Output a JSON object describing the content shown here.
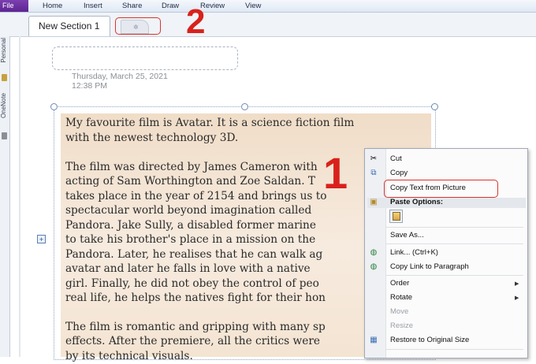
{
  "menubar": {
    "file_label": "File",
    "items": [
      "Home",
      "Insert",
      "Share",
      "Draw",
      "Review",
      "View"
    ]
  },
  "section_tab": {
    "label": "New Section 1"
  },
  "new_tab_icon": "sparkle-icon",
  "annotations": {
    "marker_1": "1",
    "marker_2": "2",
    "accent_color": "#d9211c"
  },
  "sidebar": {
    "labels": [
      "Personal",
      "OneNote"
    ]
  },
  "page": {
    "date": "Thursday, March 25, 2021",
    "time": "12:38 PM"
  },
  "picture_text": {
    "lines": [
      "My favourite film is Avatar. It is a science fiction film",
      "with the newest technology 3D.",
      "",
      "The film was directed by James Cameron with",
      "acting of Sam Worthington and Zoe Saldan. T",
      "takes place in the year of 2154 and brings us to",
      "spectacular world beyond imagination called",
      "Pandora. Jake Sully, a disabled former marine",
      "to take his brother's place in a mission on the",
      "Pandora. Later, he realises that he can walk ag",
      "avatar and later he falls in love with a native",
      "girl. Finally, he did not obey the control of peo",
      "real life, he helps the natives fight for their hon",
      "",
      "The film is romantic and gripping with many sp",
      "effects. After the premiere, all the critics were",
      "by its technical visuals."
    ]
  },
  "context_menu": {
    "cut": "Cut",
    "copy": "Copy",
    "copy_text_from_picture": "Copy Text from Picture",
    "paste_options": "Paste Options:",
    "save_as": "Save As...",
    "link": "Link...  (Ctrl+K)",
    "copy_link_to_paragraph": "Copy Link to Paragraph",
    "order": "Order",
    "rotate": "Rotate",
    "move": "Move",
    "resize": "Resize",
    "restore_original_size": "Restore to Original Size"
  }
}
